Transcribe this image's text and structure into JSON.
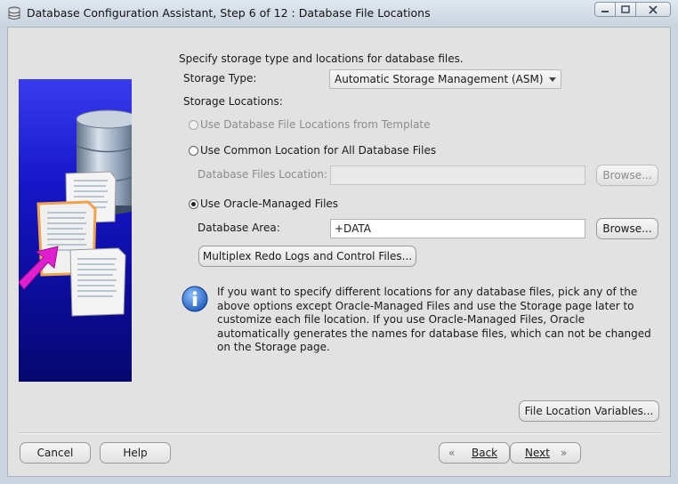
{
  "window": {
    "title": "Database Configuration Assistant, Step 6 of 12 : Database File Locations",
    "icons": [
      "database-app-icon",
      "minimize-icon",
      "maximize-icon",
      "close-icon"
    ]
  },
  "sidebar_image": {
    "doc_text": "Ntndsfitfdkfkltrh"
  },
  "main": {
    "intro": "Specify storage type and locations for database files.",
    "storage_type_label": "Storage Type:",
    "storage_type_value": "Automatic Storage Management (ASM)",
    "storage_locations_label": "Storage Locations:",
    "options": {
      "template": "Use Database File Locations from Template",
      "common": "Use Common Location for All Database Files",
      "omf": "Use Oracle-Managed Files"
    },
    "selected_option": "omf",
    "db_files_location_label": "Database Files Location:",
    "db_files_location_value": "",
    "db_area_label": "Database Area:",
    "db_area_value": "+DATA",
    "browse_label": "Browse...",
    "multiplex_button": "Multiplex Redo Logs and Control Files...",
    "info_text": "If you want to specify different locations for any database files, pick any of the above options except Oracle-Managed Files and use the Storage page later to customize each file location. If you use Oracle-Managed Files, Oracle automatically generates the names for database files, which can not be changed on the Storage page.",
    "file_location_variables_button": "File Location Variables..."
  },
  "footer": {
    "cancel": "Cancel",
    "help": "Help",
    "back": "Back",
    "next": "Next"
  },
  "colors": {
    "background": "#e2e2e2",
    "titlebar": "#c9d4df",
    "sidebar_blue": "#1616c8",
    "info_icon_blue": "#2a6fd6",
    "arrow_magenta": "#e21fd0"
  }
}
